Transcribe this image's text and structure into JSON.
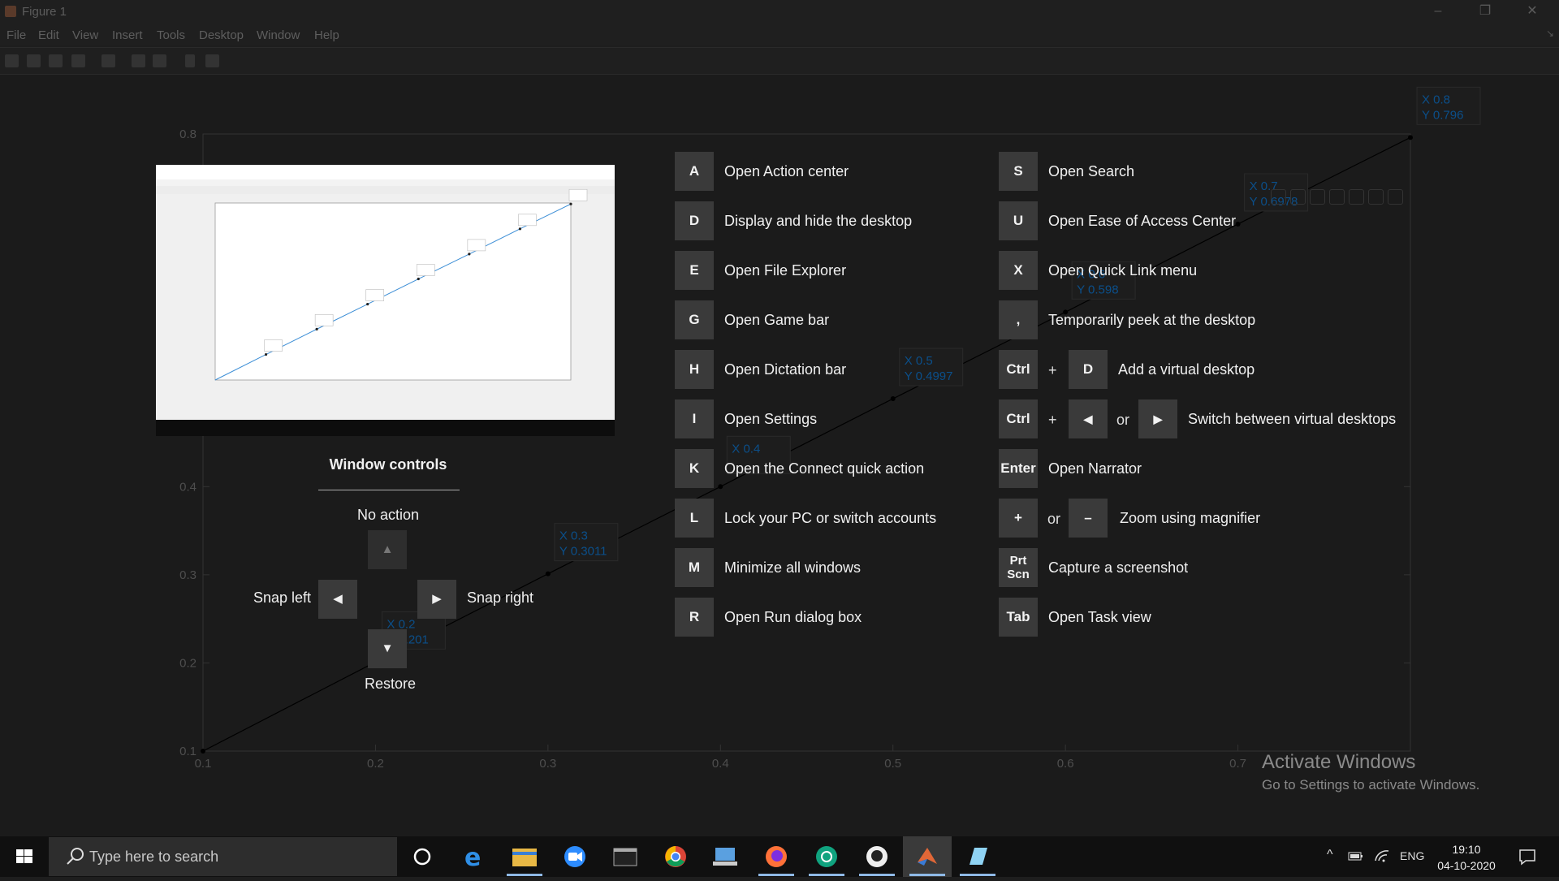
{
  "window": {
    "title": "Figure 1",
    "controls": {
      "minimize": "–",
      "maximize": "❐",
      "close": "✕"
    }
  },
  "menu": [
    "File",
    "Edit",
    "View",
    "Insert",
    "Tools",
    "Desktop",
    "Window",
    "Help"
  ],
  "toolbar": {
    "icons": [
      "new-figure-icon",
      "open-file-icon",
      "save-icon",
      "print-preview-icon",
      "print-icon",
      "toggle-colorbar-icon",
      "legend-icon",
      "edit-plot-icon",
      "property-inspector-icon"
    ]
  },
  "axes_toolbar": {
    "icons": [
      "export-icon",
      "brush-icon",
      "data-tip-icon",
      "pan-icon",
      "zoom-in-icon",
      "zoom-out-icon",
      "home-icon"
    ]
  },
  "chart_data": {
    "type": "line",
    "x": [
      0.1,
      0.2,
      0.3,
      0.4,
      0.5,
      0.6,
      0.7,
      0.8
    ],
    "y": [
      0.1,
      0.201,
      0.3011,
      0.4,
      0.4997,
      0.598,
      0.6978,
      0.796
    ],
    "xlim": [
      0.1,
      0.8
    ],
    "ylim": [
      0.1,
      0.8
    ],
    "xticks": [
      "0.1",
      "0.2",
      "0.3",
      "0.4",
      "0.5",
      "0.6",
      "0.7"
    ],
    "yticks": [
      "0.1",
      "0.2",
      "0.3",
      "0.4",
      "0.8"
    ],
    "datatips": [
      {
        "x": "X 0.2",
        "y": "Y 0.201",
        "xv": 0.2,
        "yv": 0.201
      },
      {
        "x": "X 0.3",
        "y": "Y 0.3011",
        "xv": 0.3,
        "yv": 0.3011
      },
      {
        "x": "X 0.4",
        "y": "",
        "xv": 0.4,
        "yv": 0.4
      },
      {
        "x": "X 0.5",
        "y": "Y 0.4997",
        "xv": 0.5,
        "yv": 0.4997
      },
      {
        "x": "X 0.6",
        "y": "Y 0.598",
        "xv": 0.6,
        "yv": 0.598
      },
      {
        "x": "X 0.7",
        "y": "Y 0.6978",
        "xv": 0.7,
        "yv": 0.6978
      },
      {
        "x": "X 0.8",
        "y": "Y 0.796",
        "xv": 0.8,
        "yv": 0.796
      }
    ],
    "grid": false,
    "line_color": "#000000",
    "tip_text_color": "#0b4f8a"
  },
  "shortcuts": {
    "left": [
      {
        "key": "A",
        "label": "Open Action center"
      },
      {
        "key": "D",
        "label": "Display and hide the desktop"
      },
      {
        "key": "E",
        "label": "Open File Explorer"
      },
      {
        "key": "G",
        "label": "Open Game bar"
      },
      {
        "key": "H",
        "label": "Open Dictation bar"
      },
      {
        "key": "I",
        "label": "Open Settings"
      },
      {
        "key": "K",
        "label": "Open the Connect quick action"
      },
      {
        "key": "L",
        "label": "Lock your PC or switch accounts"
      },
      {
        "key": "M",
        "label": "Minimize all windows"
      },
      {
        "key": "R",
        "label": "Open Run dialog box"
      }
    ],
    "right": [
      {
        "keys": [
          "S"
        ],
        "label": "Open Search"
      },
      {
        "keys": [
          "U"
        ],
        "label": "Open Ease of Access Center"
      },
      {
        "keys": [
          "X"
        ],
        "label": "Open Quick Link menu"
      },
      {
        "keys": [
          ","
        ],
        "label": "Temporarily peek at the desktop"
      },
      {
        "keys": [
          "Ctrl",
          "+",
          "D"
        ],
        "label": "Add a virtual desktop"
      },
      {
        "keys": [
          "Ctrl",
          "+",
          "◀",
          "or",
          "▶"
        ],
        "label": "Switch between virtual desktops"
      },
      {
        "keys": [
          "Enter"
        ],
        "label": "Open Narrator"
      },
      {
        "keys": [
          "+",
          "or",
          "–"
        ],
        "label": "Zoom using magnifier"
      },
      {
        "keys": [
          "Prt Scn"
        ],
        "label": "Capture a screenshot"
      },
      {
        "keys": [
          "Tab"
        ],
        "label": "Open Task view"
      }
    ]
  },
  "window_controls": {
    "title": "Window controls",
    "up_label": "No action",
    "left_label": "Snap left",
    "right_label": "Snap right",
    "down_label": "Restore",
    "up_arrow": "▲",
    "left_arrow": "◀",
    "right_arrow": "▶",
    "down_arrow": "▼"
  },
  "activate_windows": {
    "title": "Activate Windows",
    "subtitle": "Go to Settings to activate Windows."
  },
  "taskbar": {
    "search_placeholder": "Type here to search",
    "apps": [
      "cortana-icon",
      "edge-icon",
      "file-explorer-icon",
      "zoom-icon",
      "terminal-icon",
      "chrome-icon",
      "remote-desktop-icon",
      "firefox-icon",
      "chatgpt-icon",
      "github-icon",
      "matlab-icon",
      "app-icon"
    ],
    "tray": {
      "chevron": "^",
      "language": "ENG",
      "time": "19:10",
      "date": "04-10-2020"
    }
  }
}
